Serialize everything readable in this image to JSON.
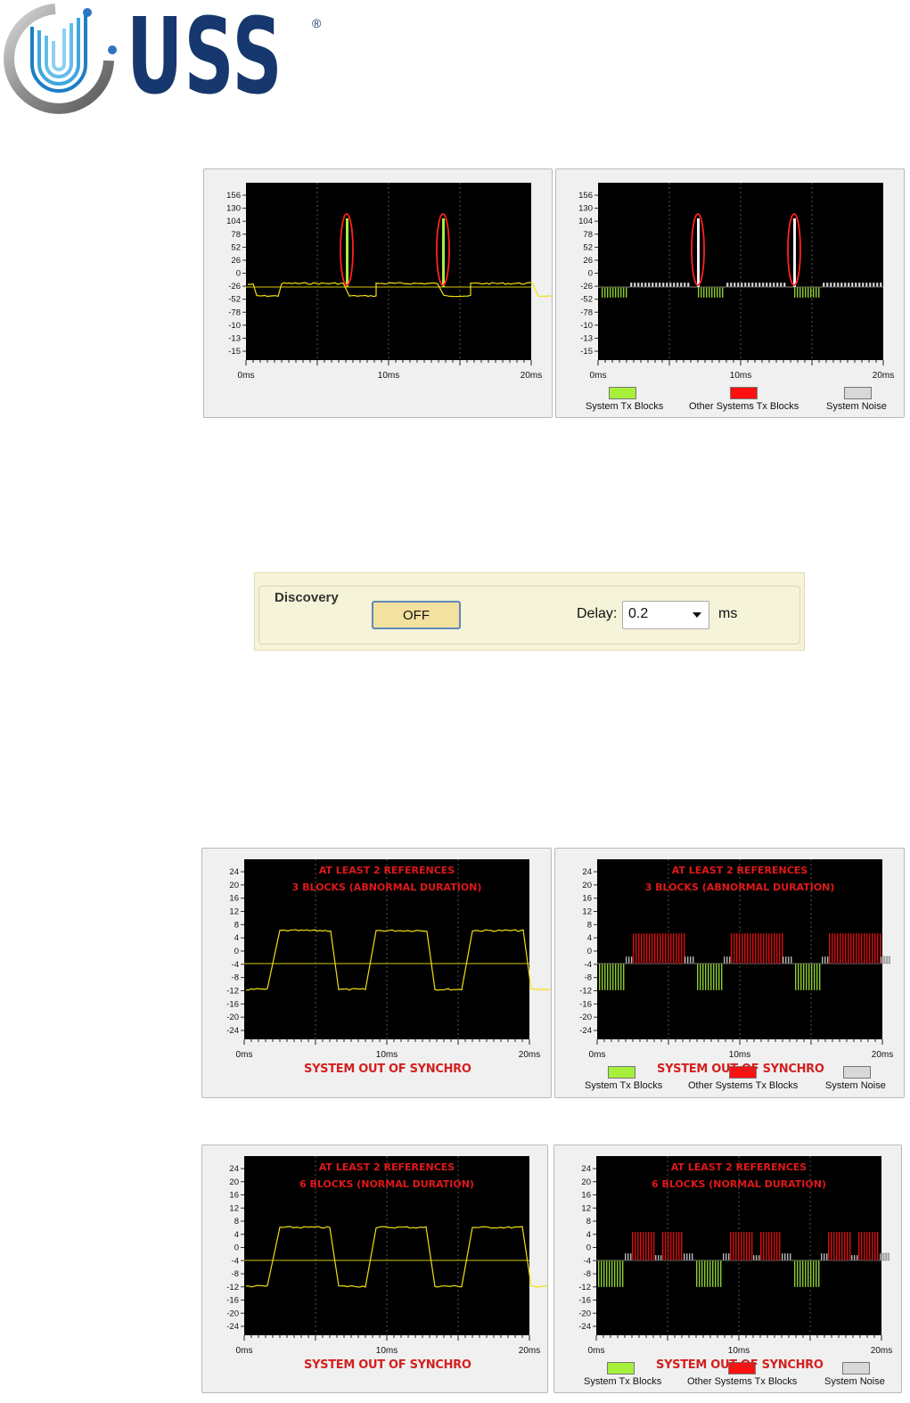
{
  "logo": {
    "text": "USS",
    "reg": "®"
  },
  "legend": {
    "system_tx": "System Tx Blocks",
    "other_tx": "Other Systems Tx Blocks",
    "noise": "System Noise"
  },
  "legend_colors": {
    "system_tx": "#a6f03c",
    "other_tx": "#ff1010",
    "noise": "#d8d8d8"
  },
  "discovery": {
    "title": "Discovery",
    "button": "OFF",
    "delay_label": "Delay:",
    "delay_value": "0.2",
    "delay_unit": "ms"
  },
  "out_of_sync": "SYSTEM OUT OF SYNCHRO",
  "chart_data": [
    {
      "type": "line",
      "mode": "trace",
      "yticks": [
        "156",
        "130",
        "104",
        "78",
        "52",
        "26",
        "0",
        "-26",
        "-52",
        "-78",
        "-10",
        "-13",
        "-15"
      ],
      "xticks": [
        "0ms",
        "10ms",
        "20ms"
      ],
      "annotations": []
    },
    {
      "type": "bar",
      "mode": "blocks",
      "yticks": [
        "156",
        "130",
        "104",
        "78",
        "52",
        "26",
        "0",
        "-26",
        "-52",
        "-78",
        "-10",
        "-13",
        "-15"
      ],
      "xticks": [
        "0ms",
        "10ms",
        "20ms"
      ],
      "annotations": []
    },
    {
      "type": "line",
      "mode": "trace",
      "yticks": [
        "24",
        "20",
        "16",
        "12",
        "8",
        "4",
        "0",
        "-4",
        "-8",
        "-12",
        "-16",
        "-20",
        "-24"
      ],
      "xticks": [
        "0ms",
        "10ms",
        "20ms"
      ],
      "annotations": [
        "AT LEAST 2 REFERENCES",
        "3 BLOCKS (ABNORMAL DURATION)"
      ]
    },
    {
      "type": "bar",
      "mode": "blocks",
      "yticks": [
        "24",
        "20",
        "16",
        "12",
        "8",
        "4",
        "0",
        "-4",
        "-8",
        "-12",
        "-16",
        "-20",
        "-24"
      ],
      "xticks": [
        "0ms",
        "10ms",
        "20ms"
      ],
      "annotations": [
        "AT LEAST 2 REFERENCES",
        "3 BLOCKS (ABNORMAL DURATION)"
      ]
    },
    {
      "type": "line",
      "mode": "trace",
      "yticks": [
        "24",
        "20",
        "16",
        "12",
        "8",
        "4",
        "0",
        "-4",
        "-8",
        "-12",
        "-16",
        "-20",
        "-24"
      ],
      "xticks": [
        "0ms",
        "10ms",
        "20ms"
      ],
      "annotations": [
        "AT LEAST 2 REFERENCES",
        "6 BLOCKS (NORMAL DURATION)"
      ]
    },
    {
      "type": "bar",
      "mode": "blocks",
      "yticks": [
        "24",
        "20",
        "16",
        "12",
        "8",
        "4",
        "0",
        "-4",
        "-8",
        "-12",
        "-16",
        "-20",
        "-24"
      ],
      "xticks": [
        "0ms",
        "10ms",
        "20ms"
      ],
      "annotations": [
        "AT LEAST 2 REFERENCES",
        "6 BLOCKS (NORMAL DURATION)"
      ]
    }
  ]
}
